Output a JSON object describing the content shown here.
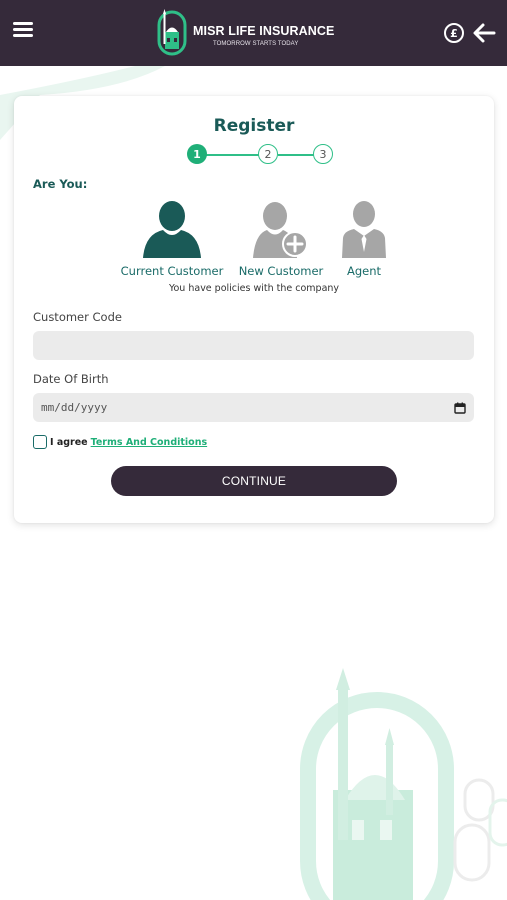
{
  "header": {
    "brand_name": "MISR LIFE INSURANCE",
    "tagline": "TOMORROW STARTS TODAY",
    "currency_symbol": "£",
    "menu_icon": "hamburger-menu-icon",
    "back_icon": "arrow-left-icon"
  },
  "register": {
    "title": "Register",
    "steps": [
      "1",
      "2",
      "3"
    ],
    "active_step": 1,
    "question": "Are You:",
    "roles": [
      {
        "label": "Current Customer",
        "icon": "user-icon",
        "selected": true
      },
      {
        "label": "New Customer",
        "icon": "user-add-icon",
        "selected": false
      },
      {
        "label": "Agent",
        "icon": "agent-icon",
        "selected": false
      }
    ],
    "role_description": "You have policies with the company",
    "customer_code": {
      "label": "Customer Code",
      "value": ""
    },
    "dob": {
      "label": "Date Of Birth",
      "placeholder": "mm/dd/yyyy"
    },
    "agree_text": "I agree",
    "terms_link": "Terms And Conditions",
    "continue_label": "CONTINUE"
  },
  "colors": {
    "header_bg": "#352a3a",
    "primary_green": "#1faf78",
    "teal": "#1a5a57",
    "selected_icon": "#1a5a57",
    "unselected_icon": "#a6a6a6",
    "input_bg": "#ebebeb"
  }
}
